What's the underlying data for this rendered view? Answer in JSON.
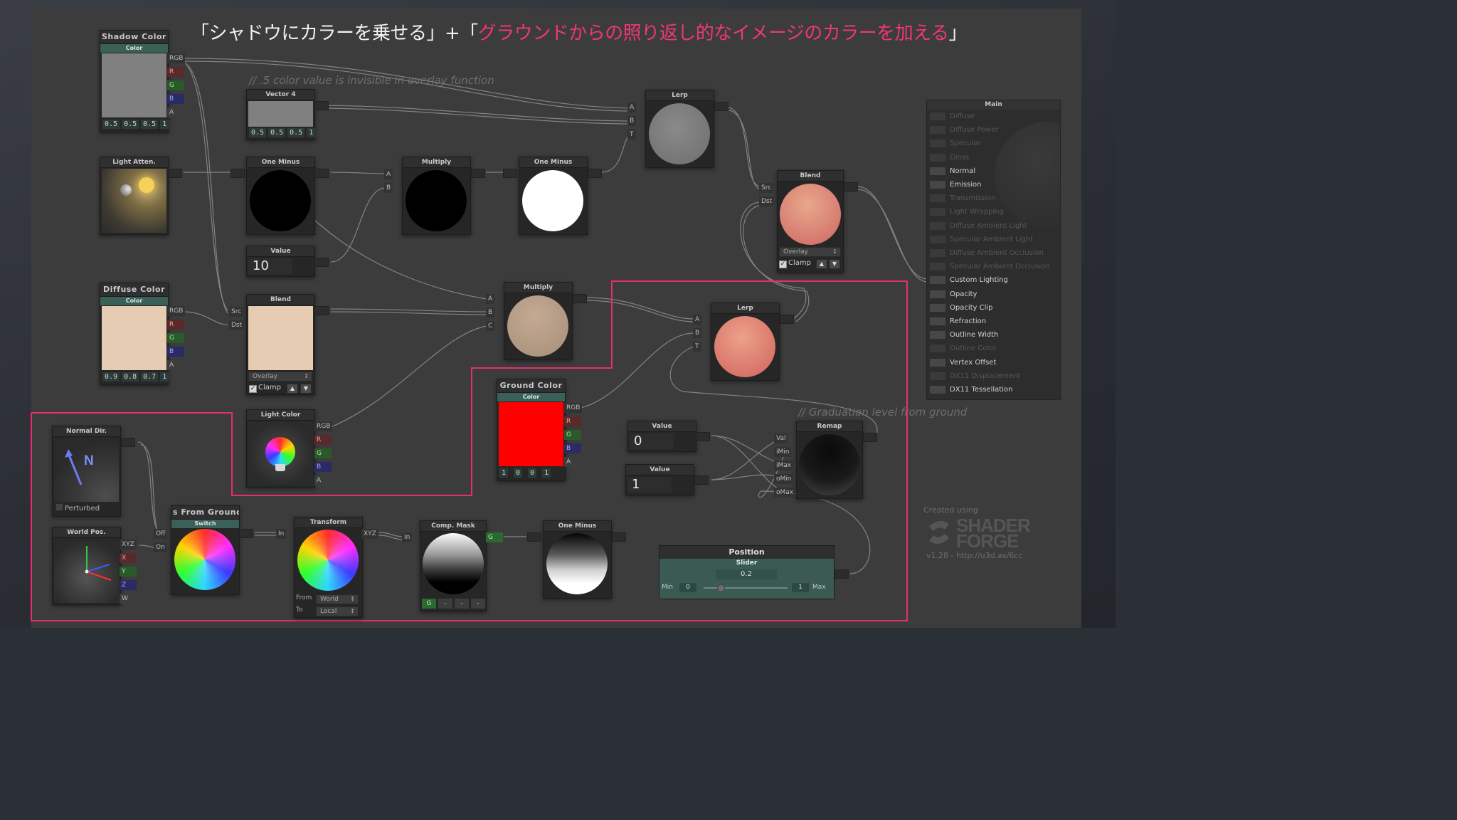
{
  "heading": {
    "prefix": "「シャドウにカラーを乗せる」+「",
    "highlight": "グラウンドからの照り返し的なイメージのカラーを加える",
    "suffix": "」"
  },
  "comments": {
    "overlay_note": "//  .5 color value is invisible in overlay function",
    "graduation_note": "//  Graduation level from ground"
  },
  "colors": {
    "highlight": "#f0367a",
    "frame_border": "#e62e6c",
    "shadow_color": "#808080",
    "diffuse_color": "#e6ccb3",
    "ground_color": "#ff0000"
  },
  "nodes": {
    "shadow_color": {
      "title": "Shadow Color",
      "subtitle": "Color",
      "values": [
        "0.5",
        "0.5",
        "0.5",
        "1"
      ],
      "ports": [
        "RGB",
        "R",
        "G",
        "B",
        "A"
      ]
    },
    "vector4": {
      "title": "Vector 4",
      "values": [
        "0.5",
        "0.5",
        "0.5",
        "1"
      ]
    },
    "lerp_top": {
      "title": "Lerp",
      "ports": [
        "A",
        "B",
        "T"
      ]
    },
    "light_atten": {
      "title": "Light Atten."
    },
    "one_minus_1": {
      "title": "One Minus"
    },
    "multiply_1": {
      "title": "Multiply",
      "ports": [
        "A",
        "B"
      ]
    },
    "one_minus_2": {
      "title": "One Minus"
    },
    "blend_right": {
      "title": "Blend",
      "ports": [
        "Src",
        "Dst"
      ],
      "mode": "Overlay",
      "clamp": "Clamp"
    },
    "value_10": {
      "title": "Value",
      "value": "10"
    },
    "diffuse_color": {
      "title": "Diffuse Color",
      "subtitle": "Color",
      "values": [
        "0.9",
        "0.8",
        "0.7",
        "1"
      ],
      "ports": [
        "RGB",
        "R",
        "G",
        "B",
        "A"
      ]
    },
    "blend_left": {
      "title": "Blend",
      "ports": [
        "Src",
        "Dst"
      ],
      "mode": "Overlay",
      "clamp": "Clamp"
    },
    "multiply_2": {
      "title": "Multiply",
      "ports": [
        "A",
        "B",
        "C"
      ]
    },
    "lerp_mid": {
      "title": "Lerp",
      "ports": [
        "A",
        "B",
        "T"
      ]
    },
    "light_color": {
      "title": "Light Color",
      "ports": [
        "RGB",
        "R",
        "G",
        "B",
        "A"
      ]
    },
    "ground_color": {
      "title": "Ground Color",
      "subtitle": "Color",
      "values": [
        "1",
        "0",
        "0",
        "1"
      ],
      "ports": [
        "RGB",
        "R",
        "G",
        "B",
        "A"
      ]
    },
    "value_0": {
      "title": "Value",
      "value": "0"
    },
    "value_1": {
      "title": "Value",
      "value": "1"
    },
    "remap": {
      "title": "Remap",
      "ports": [
        "Val",
        "iMin",
        "iMax",
        "oMin",
        "oMax"
      ]
    },
    "normal_dir": {
      "title": "Normal Dir.",
      "glyph": "N",
      "perturbed": "Perturbed"
    },
    "world_pos": {
      "title": "World Pos.",
      "ports": [
        "XYZ",
        "X",
        "Y",
        "Z",
        "W"
      ]
    },
    "switch": {
      "title": "s From Ground",
      "subtitle": "Switch",
      "ports": [
        "Off",
        "On"
      ]
    },
    "transform": {
      "title": "Transform",
      "port_in": "In",
      "port_out": "XYZ",
      "from_label": "From",
      "from_value": "World",
      "to_label": "To",
      "to_value": "Local"
    },
    "comp_mask": {
      "title": "Comp. Mask",
      "port_in": "In",
      "port_out": "G",
      "channels": [
        "G",
        "-",
        "-",
        "-"
      ]
    },
    "one_minus_3": {
      "title": "One Minus"
    },
    "position_slider": {
      "title": "Position",
      "subtitle": "Slider",
      "value": "0.2",
      "value_fraction": 0.2,
      "min_label": "Min",
      "min": "0",
      "max": "1",
      "max_label": "Max"
    }
  },
  "main_panel": {
    "title": "Main",
    "inputs": [
      {
        "label": "Diffuse",
        "active": false
      },
      {
        "label": "Diffuse Power",
        "active": false
      },
      {
        "label": "Specular",
        "active": false
      },
      {
        "label": "Gloss",
        "active": false
      },
      {
        "label": "Normal",
        "active": true
      },
      {
        "label": "Emission",
        "active": true
      },
      {
        "label": "Transmission",
        "active": false
      },
      {
        "label": "Light Wrapping",
        "active": false
      },
      {
        "label": "Diffuse Ambient Light",
        "active": false
      },
      {
        "label": "Specular Ambient Light",
        "active": false
      },
      {
        "label": "Diffuse Ambient Occlusion",
        "active": false
      },
      {
        "label": "Specular Ambient Occlusion",
        "active": false
      },
      {
        "label": "Custom Lighting",
        "active": true
      },
      {
        "label": "Opacity",
        "active": true
      },
      {
        "label": "Opacity Clip",
        "active": true
      },
      {
        "label": "Refraction",
        "active": true
      },
      {
        "label": "Outline Width",
        "active": true
      },
      {
        "label": "Outline Color",
        "active": false
      },
      {
        "label": "Vertex Offset",
        "active": true
      },
      {
        "label": "DX11 Displacement",
        "active": false
      },
      {
        "label": "DX11 Tessellation",
        "active": true
      }
    ]
  },
  "branding": {
    "created_using": "Created using",
    "logo_line1": "SHADER",
    "logo_line2": "FORGE",
    "version_url": "v1.28 - http://u3d.as/6cc"
  }
}
